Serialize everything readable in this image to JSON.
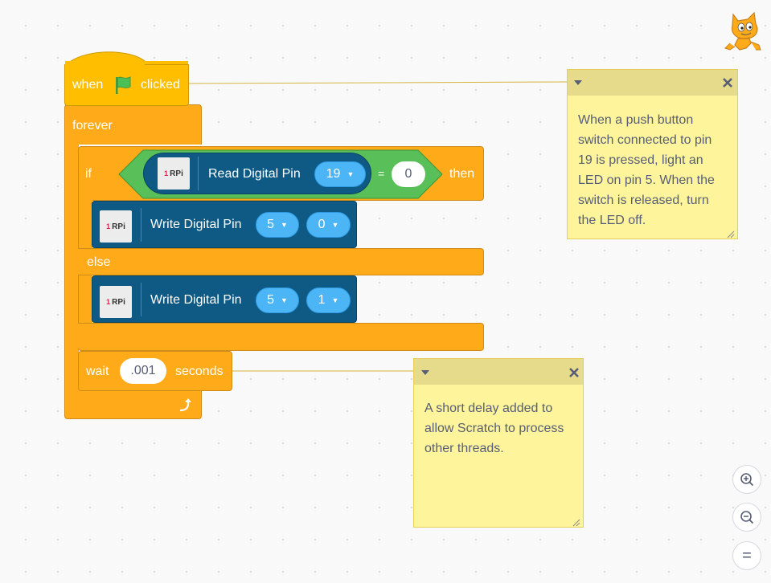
{
  "hat": {
    "when": "when",
    "clicked": "clicked"
  },
  "forever": {
    "label": "forever"
  },
  "if_block": {
    "if": "if",
    "then": "then",
    "else": "else"
  },
  "read_pin": {
    "icon_num": "1",
    "icon_text": "RPi",
    "label": "Read Digital Pin",
    "pin": "19",
    "equals": "=",
    "compare": "0"
  },
  "write1": {
    "icon_num": "1",
    "icon_text": "RPi",
    "label": "Write Digital Pin",
    "pin": "5",
    "value": "0"
  },
  "write2": {
    "icon_num": "1",
    "icon_text": "RPi",
    "label": "Write Digital Pin",
    "pin": "5",
    "value": "1"
  },
  "wait_block": {
    "wait": "wait",
    "value": ".001",
    "seconds": "seconds"
  },
  "note1": {
    "text": "When a push button switch connected to pin 19 is pressed, light an LED on pin 5. When the switch is released, turn the LED off."
  },
  "note2": {
    "text": "A short delay added to allow Scratch to process other threads."
  },
  "zoom": {
    "reset": "="
  },
  "colors": {
    "control": "#FFAB19",
    "events": "#FFBF00",
    "rpi": "#0F5A85",
    "operators": "#59C059",
    "dropdown": "#4CB5F5",
    "note": "#FEF49C"
  },
  "icons": [
    "scratch-cat-icon",
    "green-flag-icon",
    "loop-arrow-icon",
    "dropdown-arrow-icon",
    "collapse-icon",
    "close-icon",
    "zoom-in-icon",
    "zoom-out-icon"
  ]
}
